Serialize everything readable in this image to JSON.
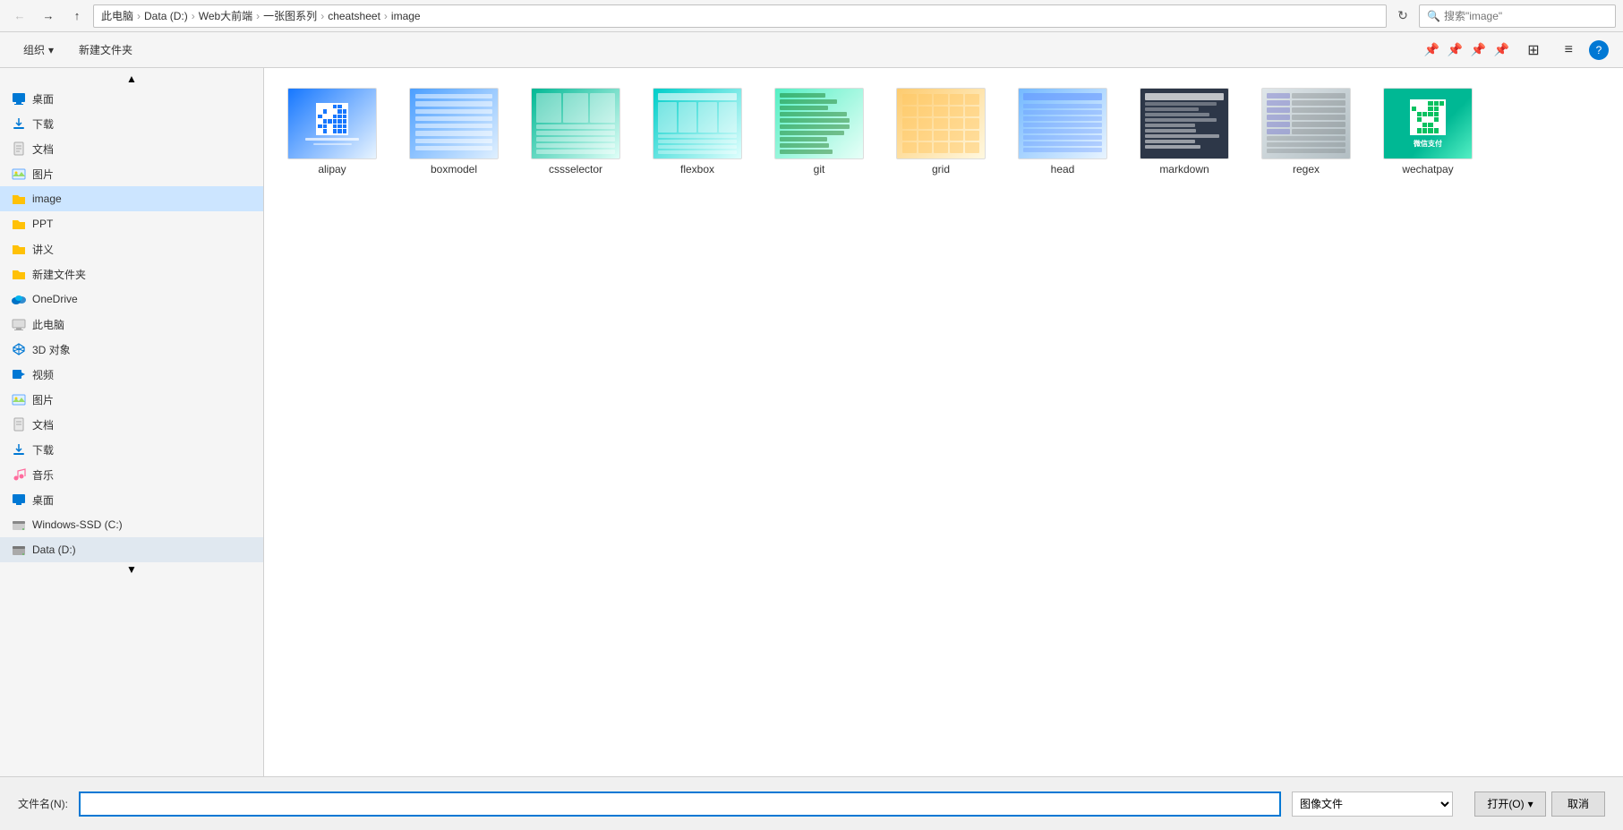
{
  "topbar": {
    "back_label": "←",
    "forward_label": "→",
    "up_label": "↑",
    "refresh_label": "↻",
    "breadcrumb": [
      "此电脑",
      "Data (D:)",
      "Web大前端",
      "一张图系列",
      "cheatsheet",
      "image"
    ],
    "search_placeholder": "搜索\"image\""
  },
  "toolbar": {
    "organize_label": "组织",
    "organize_arrow": "▾",
    "new_folder_label": "新建文件夹",
    "view_icons": [
      "▦",
      "▣",
      "❓"
    ],
    "pin_icons": [
      "📌",
      "📌",
      "📌",
      "📌"
    ]
  },
  "sidebar": {
    "items": [
      {
        "id": "desktop",
        "label": "桌面",
        "icon": "desktop"
      },
      {
        "id": "download",
        "label": "下载",
        "icon": "download"
      },
      {
        "id": "doc",
        "label": "文档",
        "icon": "doc"
      },
      {
        "id": "pic",
        "label": "图片",
        "icon": "pic"
      },
      {
        "id": "image",
        "label": "image",
        "icon": "folder-yellow"
      },
      {
        "id": "ppt",
        "label": "PPT",
        "icon": "folder-yellow"
      },
      {
        "id": "lecture",
        "label": "讲义",
        "icon": "folder-yellow"
      },
      {
        "id": "newfolder",
        "label": "新建文件夹",
        "icon": "folder-yellow"
      },
      {
        "id": "onedrive",
        "label": "OneDrive",
        "icon": "onedrive"
      },
      {
        "id": "thispc",
        "label": "此电脑",
        "icon": "thispc"
      },
      {
        "id": "3d",
        "label": "3D 对象",
        "icon": "3d"
      },
      {
        "id": "video",
        "label": "视频",
        "icon": "video"
      },
      {
        "id": "images",
        "label": "图片",
        "icon": "images"
      },
      {
        "id": "documents",
        "label": "文档",
        "icon": "documents"
      },
      {
        "id": "downloads",
        "label": "下载",
        "icon": "downloads"
      },
      {
        "id": "music",
        "label": "音乐",
        "icon": "music"
      },
      {
        "id": "desktopc",
        "label": "桌面",
        "icon": "desktopc"
      },
      {
        "id": "winc",
        "label": "Windows-SSD (C:)",
        "icon": "drive"
      },
      {
        "id": "datad",
        "label": "Data (D:)",
        "icon": "drive-selected"
      }
    ]
  },
  "files": [
    {
      "id": "alipay",
      "name": "alipay",
      "thumb_class": "thumb-alipay"
    },
    {
      "id": "boxmodel",
      "name": "boxmodel",
      "thumb_class": "thumb-boxmodel"
    },
    {
      "id": "cssselector",
      "name": "cssselector",
      "thumb_class": "thumb-cssselector"
    },
    {
      "id": "flexbox",
      "name": "flexbox",
      "thumb_class": "thumb-flexbox"
    },
    {
      "id": "git",
      "name": "git",
      "thumb_class": "thumb-git"
    },
    {
      "id": "grid",
      "name": "grid",
      "thumb_class": "thumb-grid"
    },
    {
      "id": "head",
      "name": "head",
      "thumb_class": "thumb-head"
    },
    {
      "id": "markdown",
      "name": "markdown",
      "thumb_class": "thumb-markdown"
    },
    {
      "id": "regex",
      "name": "regex",
      "thumb_class": "thumb-regex"
    },
    {
      "id": "wechatpay",
      "name": "wechatpay",
      "thumb_class": "thumb-wechatpay"
    }
  ],
  "bottom": {
    "filename_label": "文件名(N):",
    "filetype_value": "图像文件",
    "open_label": "打开(O)",
    "open_arrow": "▾",
    "cancel_label": "取消"
  }
}
